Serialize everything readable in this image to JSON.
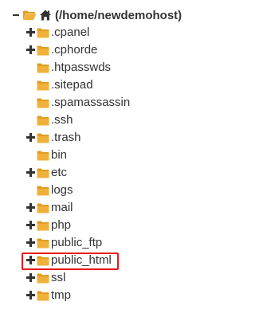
{
  "root": {
    "label": "(/home/newdemohost)",
    "toggle_icon": "minus-icon",
    "folder_icon": "folder-open-icon",
    "home_icon": "home-icon"
  },
  "colors": {
    "folder": "#f0b13a",
    "folder_dark": "#e09e22",
    "text": "#333333",
    "highlight": "#e8171c"
  },
  "items": [
    {
      "label": ".cpanel",
      "expandable": true
    },
    {
      "label": ".cphorde",
      "expandable": true
    },
    {
      "label": ".htpasswds",
      "expandable": false
    },
    {
      "label": ".sitepad",
      "expandable": false
    },
    {
      "label": ".spamassassin",
      "expandable": false
    },
    {
      "label": ".ssh",
      "expandable": false
    },
    {
      "label": ".trash",
      "expandable": true
    },
    {
      "label": "bin",
      "expandable": false
    },
    {
      "label": "etc",
      "expandable": true
    },
    {
      "label": "logs",
      "expandable": false
    },
    {
      "label": "mail",
      "expandable": true
    },
    {
      "label": "php",
      "expandable": true
    },
    {
      "label": "public_ftp",
      "expandable": true
    },
    {
      "label": "public_html",
      "expandable": true,
      "highlighted": true
    },
    {
      "label": "ssl",
      "expandable": true
    },
    {
      "label": "tmp",
      "expandable": true
    }
  ]
}
